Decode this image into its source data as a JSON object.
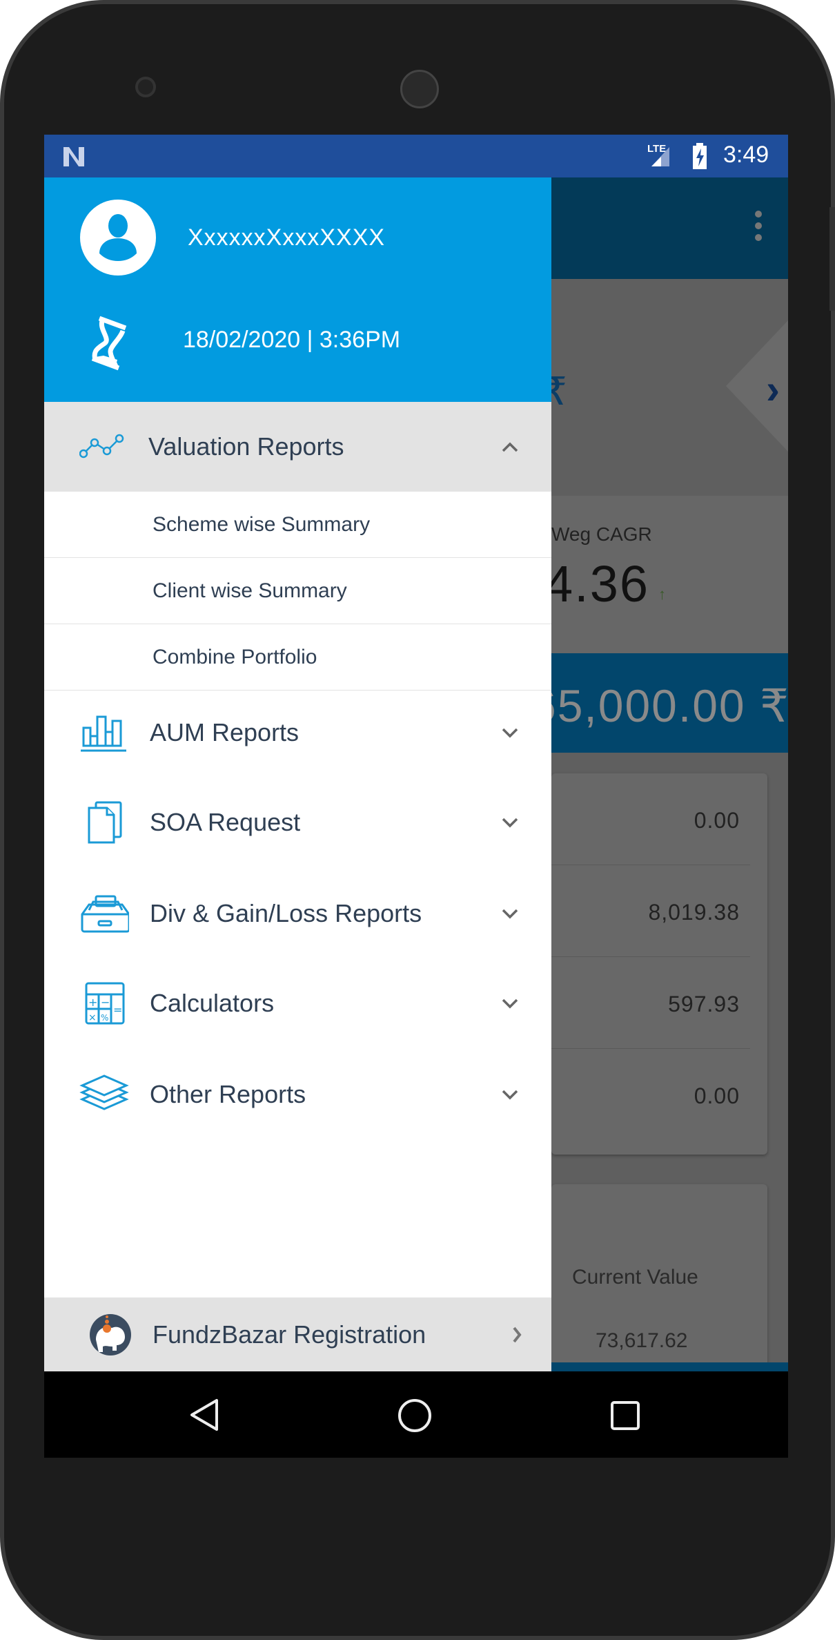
{
  "status_bar": {
    "network": "LTE",
    "time": "3:49"
  },
  "background_app": {
    "weg_cagr_label": "Weg CAGR",
    "weg_cagr_value": "4.36",
    "total_amount": "65,000.00 ₹",
    "card_values": [
      "0.00",
      "8,019.38",
      "597.93",
      "0.00"
    ],
    "current_value_label": "Current Value",
    "current_value": "73,617.62"
  },
  "drawer": {
    "user_name": "XxxxxxXxxxXXXX",
    "last_login": "18/02/2020 | 3:36PM",
    "expanded_section": {
      "label": "Valuation Reports",
      "icon": "line-chart-icon",
      "items": [
        "Scheme wise Summary",
        "Client wise Summary",
        "Combine Portfolio"
      ]
    },
    "menu": [
      {
        "label": "AUM Reports",
        "icon": "bar-chart-icon"
      },
      {
        "label": "SOA Request",
        "icon": "documents-icon"
      },
      {
        "label": "Div & Gain/Loss Reports",
        "icon": "inbox-tray-icon"
      },
      {
        "label": "Calculators",
        "icon": "calculator-icon"
      },
      {
        "label": "Other Reports",
        "icon": "layers-icon"
      }
    ],
    "footer": {
      "label": "FundzBazar Registration",
      "icon": "fundzbazar-logo"
    }
  },
  "colors": {
    "status_bar": "#1f4e9b",
    "drawer_header": "#029be0",
    "icon_accent": "#1a9ad6",
    "text": "#2f3f53"
  }
}
